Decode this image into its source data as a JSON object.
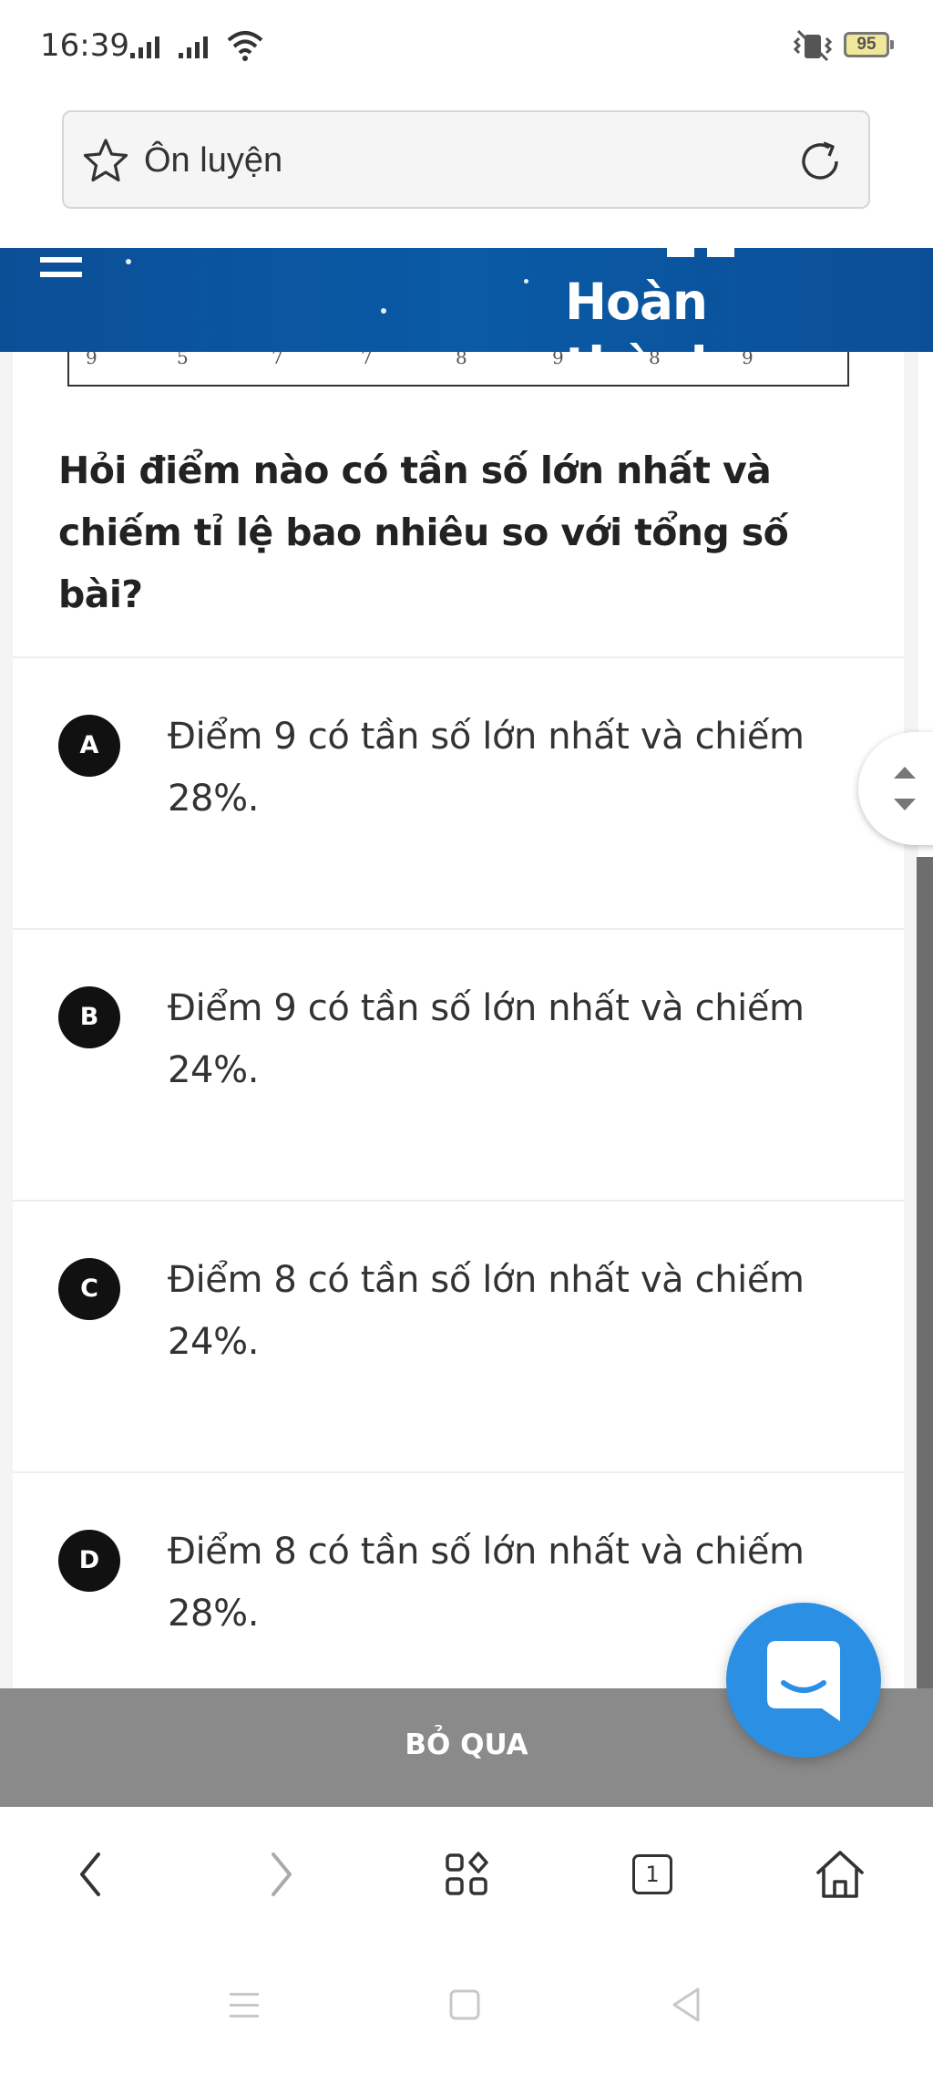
{
  "status_bar": {
    "time": "16:39",
    "battery": "95",
    "icons": [
      "signal-icon",
      "signal-icon",
      "wifi-icon",
      "vibrate-icon",
      "battery-icon"
    ]
  },
  "browser": {
    "address_text": "Ôn luyện",
    "tab_count": "1",
    "icons": [
      "star-icon",
      "reload-icon",
      "back-icon",
      "forward-icon",
      "apps-icon",
      "tabs-icon",
      "home-icon"
    ]
  },
  "header": {
    "done_label": "Hoàn thành",
    "background_color": "#0b4f97"
  },
  "table_remnant": {
    "visible_digits": [
      "9",
      "5",
      "7",
      "7",
      "8",
      "9",
      "8",
      "9"
    ]
  },
  "question": {
    "text": "Hỏi điểm nào có tần số lớn nhất và chiếm tỉ lệ bao nhiêu so với tổng số bài?"
  },
  "options": [
    {
      "letter": "A",
      "text": "Điểm 9 có tần số lớn nhất và chiếm 28%."
    },
    {
      "letter": "B",
      "text": "Điểm 9 có tần số lớn nhất và chiếm 24%."
    },
    {
      "letter": "C",
      "text": "Điểm 8 có tần số lớn nhất và chiếm 24%."
    },
    {
      "letter": "D",
      "text": "Điểm 8 có tần số lớn nhất và chiếm 28%."
    }
  ],
  "skip": {
    "label": "BỎ QUA",
    "background_color": "#8a8a8a"
  },
  "chat": {
    "icon": "chat-icon",
    "color": "#2b8fe4"
  }
}
